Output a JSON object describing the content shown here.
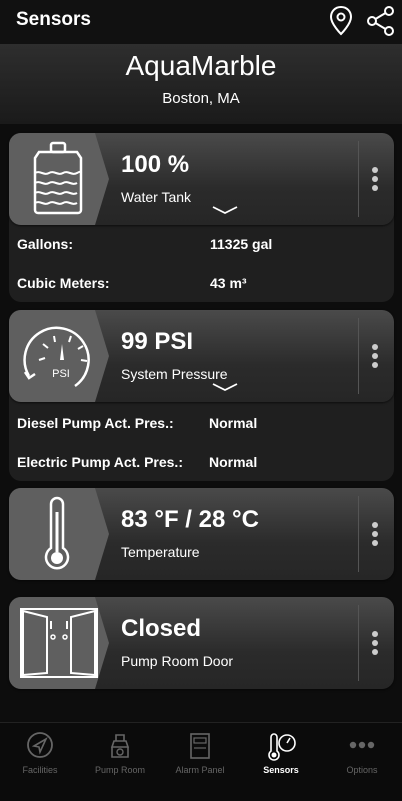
{
  "topbar": {
    "title": "Sensors"
  },
  "facility": {
    "name": "AquaMarble",
    "location": "Boston, MA"
  },
  "cards": [
    {
      "value": "100 %",
      "label": "Water Tank",
      "details": [
        {
          "name": "Gallons:",
          "value": "11325 gal"
        },
        {
          "name": "Cubic Meters:",
          "value": "43 m³"
        }
      ]
    },
    {
      "value": "99 PSI",
      "label": "System Pressure",
      "gauge_text": "PSI",
      "details": [
        {
          "name": "Diesel Pump Act. Pres.:",
          "value": "Normal"
        },
        {
          "name": "Electric Pump Act. Pres.:",
          "value": "Normal"
        }
      ]
    },
    {
      "value": "83 °F / 28 °C",
      "label": "Temperature"
    },
    {
      "value": "Closed",
      "label": "Pump Room Door"
    }
  ],
  "nav": [
    {
      "label": "Facilities"
    },
    {
      "label": "Pump Room"
    },
    {
      "label": "Alarm Panel"
    },
    {
      "label": "Sensors"
    },
    {
      "label": "Options"
    }
  ],
  "colors": {
    "background": "#0d0d0d",
    "card": "#2b2b2b",
    "icon_box": "#5f5f5f",
    "nav_inactive": "#666666",
    "nav_active": "#ffffff"
  }
}
